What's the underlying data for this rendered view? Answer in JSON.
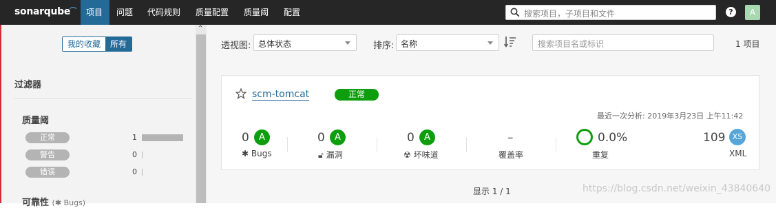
{
  "nav": {
    "logo": "sonarqube",
    "items": [
      "项目",
      "问题",
      "代码规则",
      "质量配置",
      "质量阈",
      "配置"
    ],
    "search_placeholder": "搜索项目，子项目和文件",
    "help": "?",
    "avatar": "A"
  },
  "sidebar": {
    "toggle": {
      "favorites": "我的收藏",
      "all": "所有"
    },
    "filters_title": "过滤器",
    "quality_gate": {
      "title": "质量阈",
      "rows": [
        {
          "label": "正常",
          "count": "1",
          "fraction": 1.0
        },
        {
          "label": "警告",
          "count": "0",
          "fraction": 0
        },
        {
          "label": "错误",
          "count": "0",
          "fraction": 0
        }
      ]
    },
    "reliability": {
      "title": "可靠性",
      "sub": "Bugs"
    }
  },
  "toolbar": {
    "perspective_label": "透视图:",
    "perspective_value": "总体状态",
    "sort_label": "排序:",
    "sort_value": "名称",
    "search_placeholder": "搜索项目名或标识",
    "count": "1 项目"
  },
  "project": {
    "name": "scm-tomcat",
    "status": "正常",
    "last_analysis": "最近一次分析: 2019年3月23日 上午11:42",
    "metrics": {
      "bugs": {
        "value": "0",
        "rating": "A",
        "label": "Bugs"
      },
      "vulnerabilities": {
        "value": "0",
        "rating": "A",
        "label": "漏洞"
      },
      "code_smells": {
        "value": "0",
        "rating": "A",
        "label": "坏味道"
      },
      "coverage": {
        "value": "–",
        "label": "覆盖率"
      },
      "duplications": {
        "value": "0.0%",
        "label": "重复"
      },
      "size": {
        "value": "109",
        "badge": "XS",
        "label": "XML"
      }
    }
  },
  "pager": "显示 1 / 1",
  "watermark": "https://blog.csdn.net/weixin_43840640",
  "colors": {
    "nav_bg": "#262626",
    "accent": "#236a97",
    "ok_green": "#0d9e0d",
    "size_badge": "#58a6d8"
  }
}
